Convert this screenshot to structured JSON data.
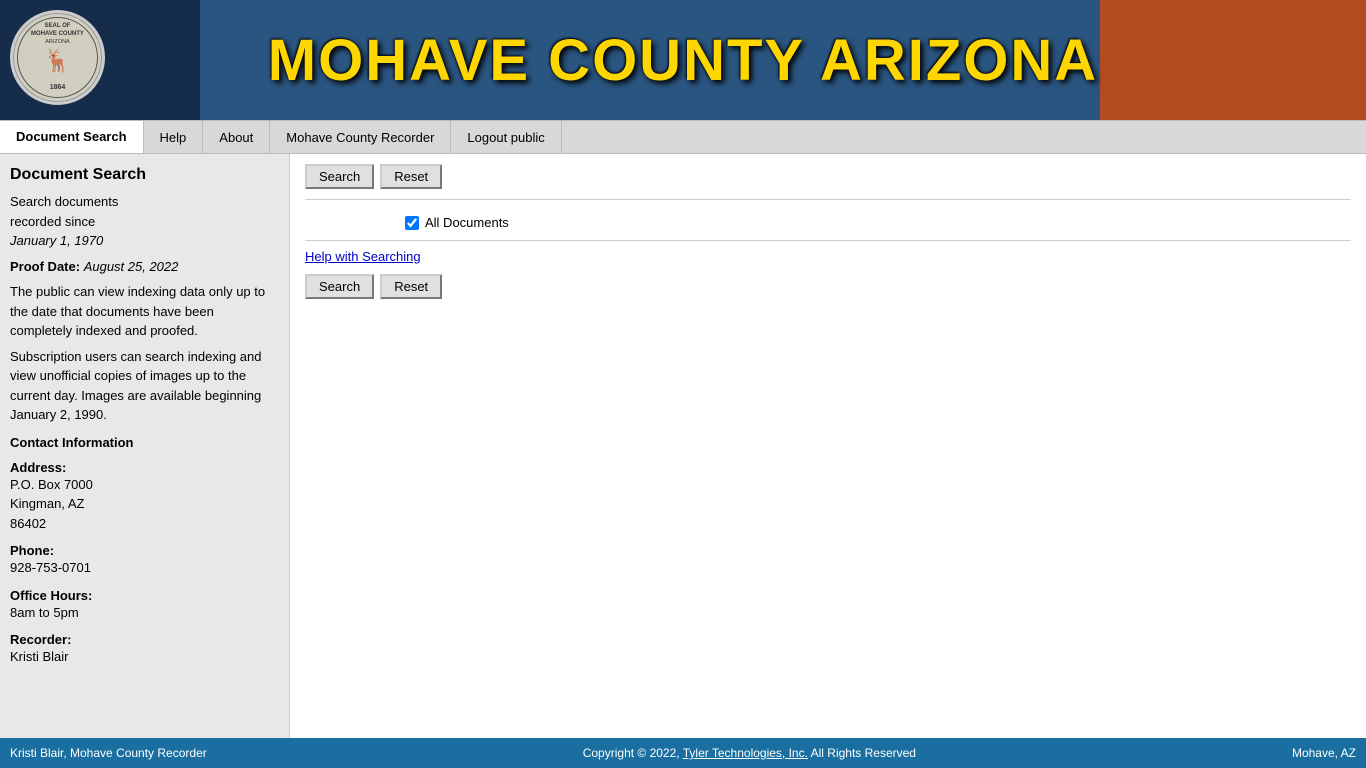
{
  "header": {
    "title": "MOHAVE COUNTY ARIZONA",
    "seal_text": "SEAL OF MOHAVE COUNTY ARIZONA 1864"
  },
  "nav": {
    "tabs": [
      {
        "id": "document-search",
        "label": "Document Search",
        "active": true
      },
      {
        "id": "help",
        "label": "Help",
        "active": false
      },
      {
        "id": "about",
        "label": "About",
        "active": false
      },
      {
        "id": "mohave-recorder",
        "label": "Mohave County Recorder",
        "active": false
      },
      {
        "id": "logout",
        "label": "Logout public",
        "active": false
      }
    ]
  },
  "sidebar": {
    "title": "Document Search",
    "description_line1": "Search documents",
    "description_line2": "recorded since",
    "description_date": "January 1, 1970",
    "proof_date_label": "Proof Date:",
    "proof_date_value": "August 25, 2022",
    "public_note": "The public can view indexing data only up to the date that documents have been completely indexed and proofed.",
    "subscription_note": "Subscription users can search indexing and view unofficial copies of images up to the current day. Images are available beginning January 2, 1990.",
    "contact_title": "Contact Information",
    "address_label": "Address:",
    "address_line1": "P.O. Box 7000",
    "address_line2": "Kingman, AZ",
    "address_line3": "86402",
    "phone_label": "Phone:",
    "phone_value": "928-753-0701",
    "hours_label": "Office Hours:",
    "hours_value": "8am to 5pm",
    "recorder_label": "Recorder:",
    "recorder_value": "Kristi Blair"
  },
  "content": {
    "search_button_label": "Search",
    "reset_button_label_top": "Reset",
    "all_documents_label": "All Documents",
    "all_documents_checked": true,
    "help_link_label": "Help with Searching",
    "search_button_label2": "Search",
    "reset_button_label_bottom": "Reset"
  },
  "footer": {
    "left_text": "Kristi Blair, Mohave County Recorder",
    "copyright_text": "Copyright © 2022,",
    "company_name": "Tyler Technologies, Inc.",
    "rights_text": "All Rights Reserved",
    "location": "Mohave, AZ"
  }
}
